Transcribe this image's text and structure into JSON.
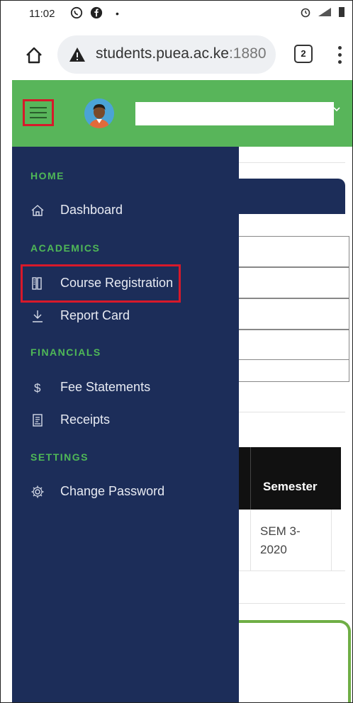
{
  "status_bar": {
    "time": "11:02",
    "dot": "•"
  },
  "browser": {
    "url_host": "students.puea.ac.ke",
    "url_port": ":1880",
    "tab_count": "2"
  },
  "header": {
    "user_name": ""
  },
  "sidebar": {
    "sections": {
      "home": "HOME",
      "academics": "ACADEMICS",
      "financials": "FINANCIALS",
      "settings": "SETTINGS"
    },
    "items": [
      {
        "label": "Dashboard",
        "icon": "home-icon"
      },
      {
        "label": "Course Registration",
        "icon": "course-book-icon"
      },
      {
        "label": "Report Card",
        "icon": "download-icon"
      },
      {
        "label": "Fee Statements",
        "icon": "dollar-icon"
      },
      {
        "label": "Receipts",
        "icon": "receipt-icon"
      },
      {
        "label": "Change Password",
        "icon": "gear-icon"
      }
    ]
  },
  "background_table": {
    "header": "Semester",
    "cell_line1": "SEM 3-",
    "cell_line2": "2020"
  },
  "colors": {
    "header_green": "#58b55a",
    "sidebar_navy": "#1c2d59",
    "section_green": "#4fb857",
    "highlight_red": "#d7192a"
  }
}
